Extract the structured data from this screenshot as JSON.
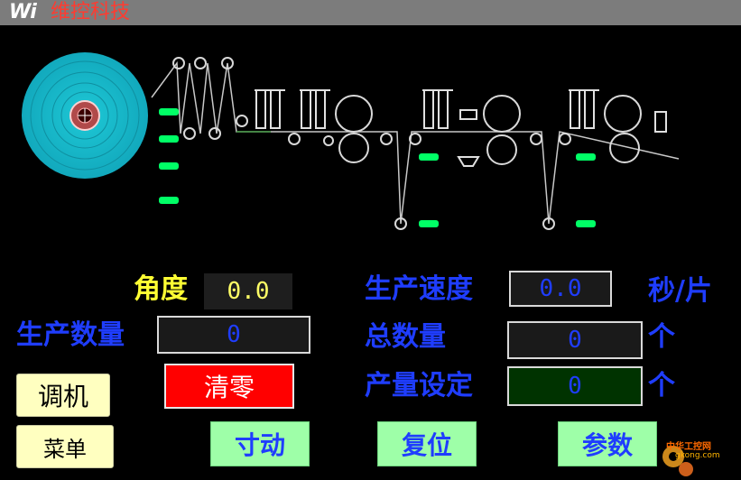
{
  "header": {
    "logo": "Wi",
    "company": "维控科技"
  },
  "labels": {
    "angle": "角度",
    "production_qty": "生产数量",
    "production_speed": "生产速度",
    "total_qty": "总数量",
    "output_setting": "产量设定",
    "speed_unit": "秒/片",
    "unit_piece_1": "个",
    "unit_piece_2": "个"
  },
  "values": {
    "angle": "0.0",
    "production_qty": "0",
    "production_speed": "0.0",
    "total_qty": "0",
    "output_setting": "0"
  },
  "buttons": {
    "adjust": "调机",
    "menu": "菜单",
    "clear": "清零",
    "jog": "寸动",
    "reset": "复位",
    "params": "参数"
  },
  "watermark": {
    "text": "中华工控网",
    "sub": "gkong.com"
  },
  "colors": {
    "title_bar": "#7c7c7c",
    "title_text": "#ff3b30",
    "label_yellow": "#ffff33",
    "label_blue": "#1f3dff",
    "indicator_green": "#00ff66",
    "reel_cyan": "#19c8d8"
  }
}
